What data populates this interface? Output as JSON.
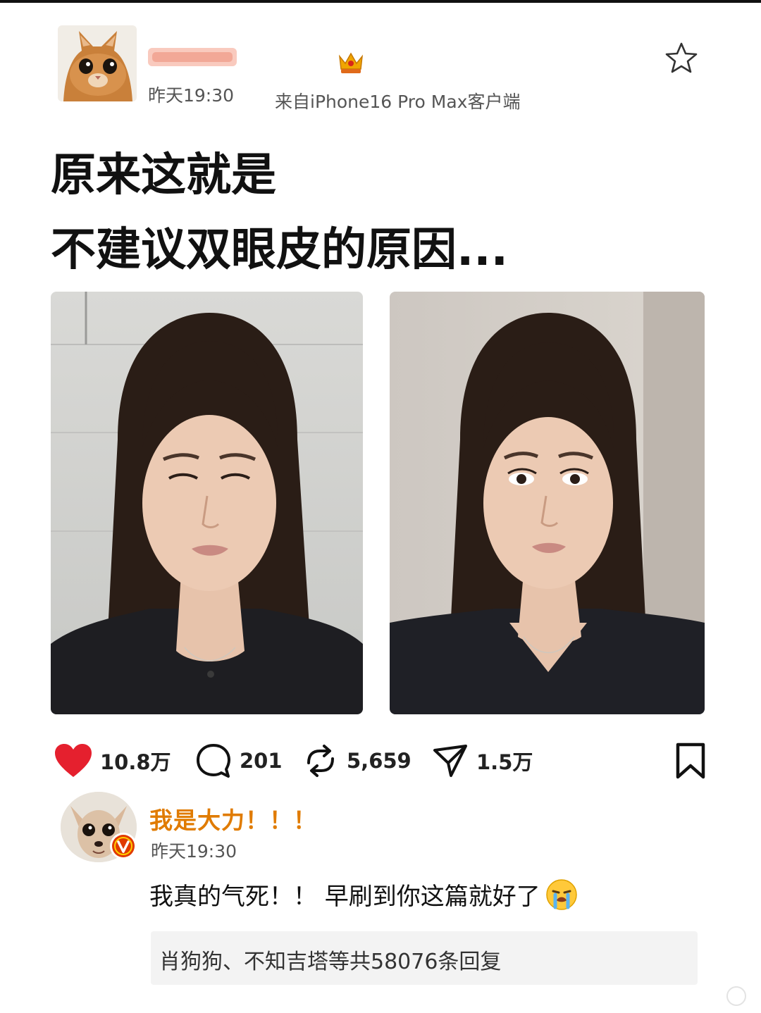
{
  "post": {
    "time": "昨天19:30",
    "source": "来自iPhone16 Pro Max客户端",
    "title_line1": "原来这就是",
    "title_line2": "不建议双眼皮的原因..."
  },
  "actions": {
    "likes": "10.8万",
    "comments": "201",
    "reposts": "5,659",
    "shares": "1.5万"
  },
  "comment": {
    "author": "我是大力！！！",
    "time": "昨天19:30",
    "text": "我真的气死！！ 早刷到你这篇就好了",
    "replies_summary": "肖狗狗、不知吉塔等共58076条回复"
  },
  "colors": {
    "like": "#e5202e",
    "author_name": "#e07b00",
    "verified": "#e03a00",
    "crown": "#f0a500"
  },
  "icons": [
    "star-icon",
    "crown-icon",
    "heart-icon",
    "comment-bubble-icon",
    "repost-icon",
    "share-icon",
    "bookmark-icon",
    "verified-v-icon",
    "crying-emoji-icon"
  ]
}
